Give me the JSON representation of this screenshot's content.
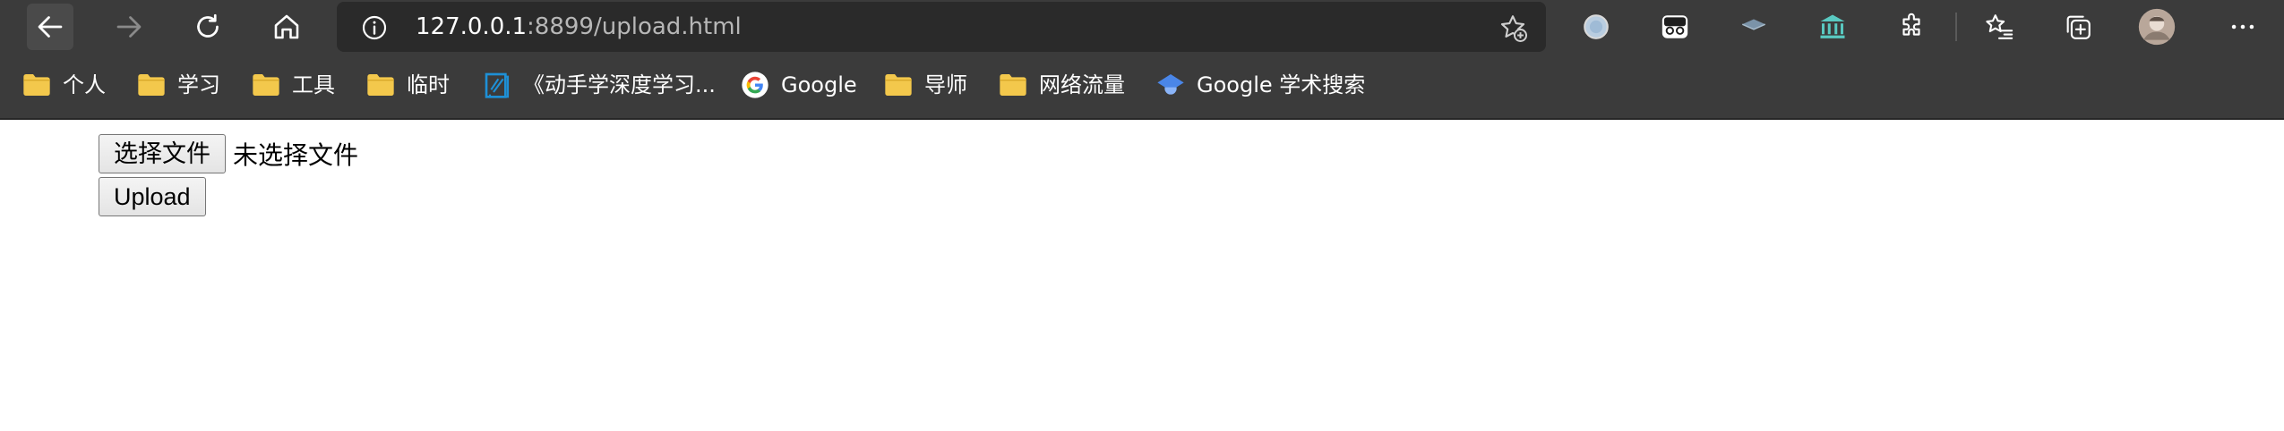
{
  "address_bar": {
    "url_host": "127.0.0.1",
    "url_rest": ":8899/upload.html"
  },
  "favorites": [
    {
      "label": "个人",
      "icon": "folder-icon"
    },
    {
      "label": "学习",
      "icon": "folder-icon"
    },
    {
      "label": "工具",
      "icon": "folder-icon"
    },
    {
      "label": "临时",
      "icon": "folder-icon"
    },
    {
      "label": "《动手学深度学习...",
      "icon": "book-icon"
    },
    {
      "label": "Google",
      "icon": "google-icon"
    },
    {
      "label": "导师",
      "icon": "folder-icon"
    },
    {
      "label": "网络流量",
      "icon": "folder-icon"
    },
    {
      "label": "Google 学术搜索",
      "icon": "scholar-icon"
    }
  ],
  "form": {
    "choose_file_label": "选择文件",
    "file_status": "未选择文件",
    "upload_label": "Upload"
  },
  "colors": {
    "chrome_bg": "#3b3b3b",
    "address_bg": "#2a2a2a",
    "folder_yellow": "#f3c84c"
  }
}
